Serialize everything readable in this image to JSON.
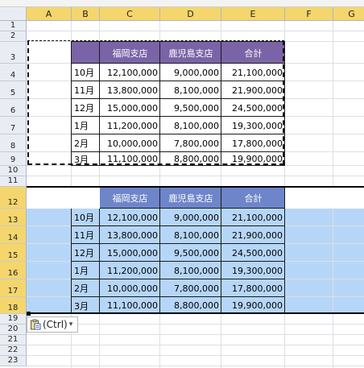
{
  "columns": [
    "A",
    "B",
    "C",
    "D",
    "E",
    "F",
    "G"
  ],
  "rows": [
    "1",
    "2",
    "3",
    "4",
    "5",
    "6",
    "7",
    "8",
    "9",
    "10",
    "11",
    "12",
    "13",
    "14",
    "15",
    "16",
    "17",
    "18",
    "19",
    "20",
    "21",
    "22",
    "23"
  ],
  "table": {
    "headers": [
      "福岡支店",
      "鹿児島支店",
      "合計"
    ],
    "months": [
      "10月",
      "11月",
      "12月",
      "1月",
      "2月",
      "3月"
    ],
    "values": [
      [
        "12,100,000",
        "9,000,000",
        "21,100,000"
      ],
      [
        "13,800,000",
        "8,100,000",
        "21,900,000"
      ],
      [
        "15,000,000",
        "9,500,000",
        "24,500,000"
      ],
      [
        "11,200,000",
        "8,100,000",
        "19,300,000"
      ],
      [
        "10,000,000",
        "7,800,000",
        "17,800,000"
      ],
      [
        "11,100,000",
        "8,800,000",
        "19,900,000"
      ]
    ]
  },
  "paste_options": {
    "label": "(Ctrl)",
    "arrow": "▾"
  },
  "colors": {
    "header_purple": "#7a64a7",
    "header_blue": "#6e85c9",
    "selection": "#b6d6f8",
    "column_header_selected": "#f5d66d",
    "row_header_selected": "#f5d66d"
  }
}
